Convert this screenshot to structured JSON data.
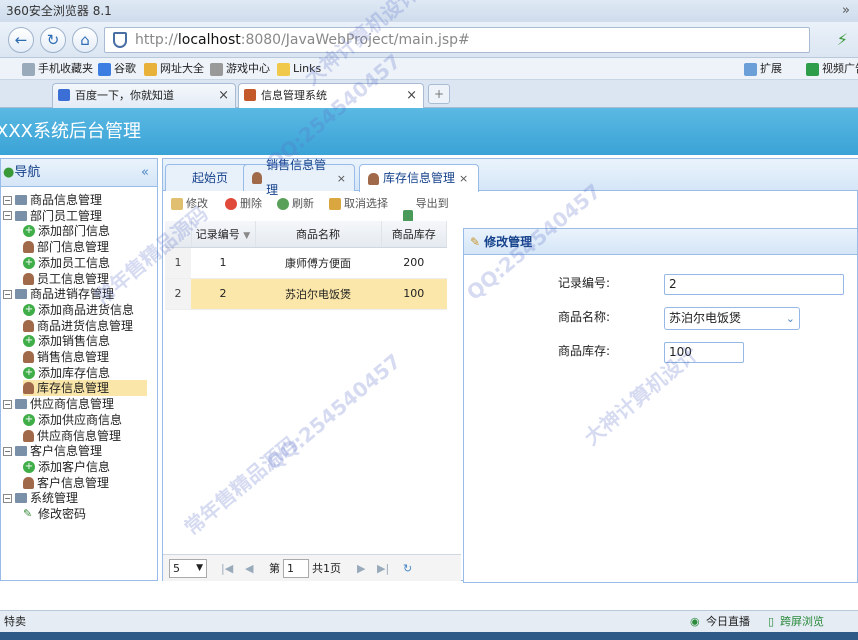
{
  "browser": {
    "title": "360安全浏览器 8.1",
    "more": "»",
    "url_prefix": "http://",
    "url_host": "localhost",
    "url_rest": ":8080/JavaWebProject/main.jsp#",
    "bookmarks": [
      "手机收藏夹",
      "谷歌",
      "网址大全",
      "游戏中心",
      "Links"
    ],
    "bookmark_right": [
      "扩展",
      "视频广告"
    ],
    "tabs": [
      {
        "label": "百度一下，你就知道"
      },
      {
        "label": "信息管理系统"
      }
    ],
    "new_tab": "+",
    "status_left": "特卖",
    "status_items": [
      "今日直播",
      "跨屏浏览"
    ]
  },
  "app": {
    "header_title": "XXX系统后台管理",
    "nav_title": "导航",
    "nav_collapse": "«",
    "tree": [
      {
        "label": "商品信息管理",
        "kind": "folder",
        "level": 0
      },
      {
        "label": "部门员工管理",
        "kind": "folder",
        "level": 0
      },
      {
        "label": "添加部门信息",
        "kind": "add",
        "level": 1
      },
      {
        "label": "部门信息管理",
        "kind": "user",
        "level": 1
      },
      {
        "label": "添加员工信息",
        "kind": "add",
        "level": 1
      },
      {
        "label": "员工信息管理",
        "kind": "user",
        "level": 1
      },
      {
        "label": "商品进销存管理",
        "kind": "folder",
        "level": 0
      },
      {
        "label": "添加商品进货信息",
        "kind": "add",
        "level": 1
      },
      {
        "label": "商品进货信息管理",
        "kind": "user",
        "level": 1
      },
      {
        "label": "添加销售信息",
        "kind": "add",
        "level": 1
      },
      {
        "label": "销售信息管理",
        "kind": "user",
        "level": 1
      },
      {
        "label": "添加库存信息",
        "kind": "add",
        "level": 1
      },
      {
        "label": "库存信息管理",
        "kind": "user",
        "level": 1,
        "selected": true
      },
      {
        "label": "供应商信息管理",
        "kind": "folder",
        "level": 0
      },
      {
        "label": "添加供应商信息",
        "kind": "add",
        "level": 1
      },
      {
        "label": "供应商信息管理",
        "kind": "user",
        "level": 1
      },
      {
        "label": "客户信息管理",
        "kind": "folder",
        "level": 0
      },
      {
        "label": "添加客户信息",
        "kind": "add",
        "level": 1
      },
      {
        "label": "客户信息管理",
        "kind": "user",
        "level": 1
      },
      {
        "label": "系统管理",
        "kind": "folder",
        "level": 0
      },
      {
        "label": "修改密码",
        "kind": "key",
        "level": 1
      }
    ],
    "content_tabs": [
      {
        "label": "起始页"
      },
      {
        "label": "销售信息管理"
      },
      {
        "label": "库存信息管理"
      }
    ],
    "toolbar": {
      "edit": "修改",
      "delete": "删除",
      "refresh": "刷新",
      "cancel_select": "取消选择",
      "export": "导出到excel"
    },
    "grid": {
      "columns": [
        "记录编号",
        "商品名称",
        "商品库存"
      ],
      "rows": [
        {
          "rn": "1",
          "id": "1",
          "name": "康师傅方便面",
          "stock": "200"
        },
        {
          "rn": "2",
          "id": "2",
          "name": "苏泊尔电饭煲",
          "stock": "100"
        }
      ]
    },
    "pager": {
      "page_size": "5",
      "page_label": "第",
      "page_value": "1",
      "total": "共1页"
    },
    "edit_dialog": {
      "title": "修改管理",
      "id_label": "记录编号:",
      "id_value": "2",
      "name_label": "商品名称:",
      "name_value": "苏泊尔电饭煲",
      "stock_label": "商品库存:",
      "stock_value": "100"
    }
  },
  "watermarks": [
    "大神计算机设计",
    "QQ:254540457",
    "常年售精品源码"
  ],
  "colors": {
    "header": "#3aa3d6",
    "selected_row": "#fbe7a9",
    "panel_border": "#99bbe8"
  }
}
